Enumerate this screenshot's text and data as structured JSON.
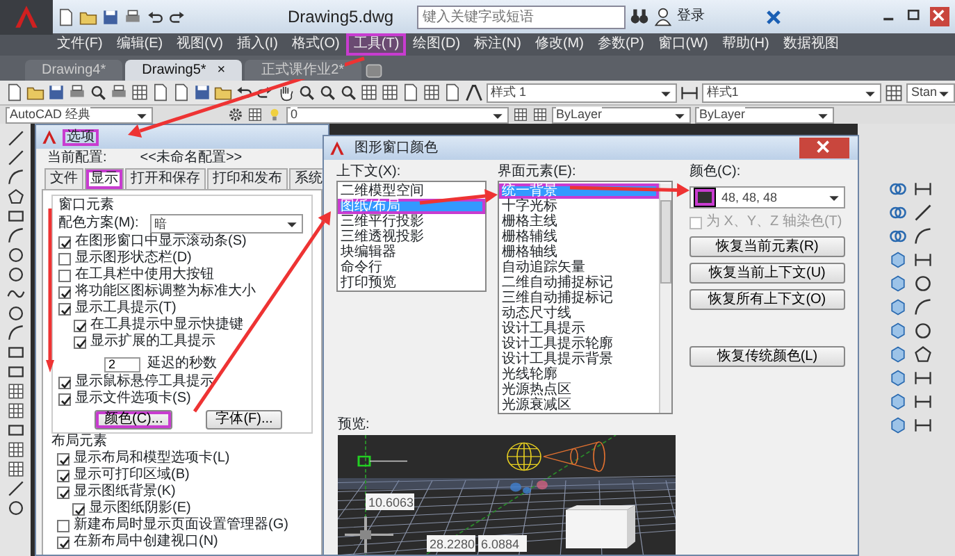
{
  "app": {
    "title": "Drawing5.dwg",
    "search_placeholder": "键入关键字或短语",
    "user": "登录"
  },
  "menu": [
    {
      "label": "文件(F)",
      "highlighted": false
    },
    {
      "label": "编辑(E)",
      "highlighted": false
    },
    {
      "label": "视图(V)",
      "highlighted": false
    },
    {
      "label": "插入(I)",
      "highlighted": false
    },
    {
      "label": "格式(O)",
      "highlighted": false
    },
    {
      "label": "工具(T)",
      "highlighted": true
    },
    {
      "label": "绘图(D)",
      "highlighted": false
    },
    {
      "label": "标注(N)",
      "highlighted": false
    },
    {
      "label": "修改(M)",
      "highlighted": false
    },
    {
      "label": "参数(P)",
      "highlighted": false
    },
    {
      "label": "窗口(W)",
      "highlighted": false
    },
    {
      "label": "帮助(H)",
      "highlighted": false
    },
    {
      "label": "数据视图",
      "highlighted": false
    }
  ],
  "doc_tabs": [
    {
      "label": "Drawing4*",
      "selected": false
    },
    {
      "label": "Drawing5*",
      "selected": true,
      "close": "×"
    },
    {
      "label": "正式课作业2*",
      "selected": false
    }
  ],
  "toolbar": {
    "text_style": "样式 1",
    "dim_style": "样式1",
    "table_style": "Stan"
  },
  "properties_bar": {
    "workspace": "AutoCAD 经典",
    "layer": "0",
    "color_setting": "ByLayer",
    "linetype": "ByLayer"
  },
  "options_dialog": {
    "title": "选项",
    "title_highlighted": true,
    "profile_label": "当前配置:",
    "profile": "<<未命名配置>>",
    "tabs": [
      {
        "label": "文件",
        "selected": false,
        "highlighted": false
      },
      {
        "label": "显示",
        "selected": true,
        "highlighted": true
      },
      {
        "label": "打开和保存",
        "selected": false,
        "highlighted": false
      },
      {
        "label": "打印和发布",
        "selected": false,
        "highlighted": false
      },
      {
        "label": "系统",
        "selected": false,
        "highlighted": false
      }
    ],
    "window_elements": {
      "title": "窗口元素",
      "scheme_label": "配色方案(M):",
      "scheme": "暗",
      "options": [
        {
          "kind": "checkbox",
          "label": "在图形窗口中显示滚动条(S)",
          "checked": true
        },
        {
          "kind": "checkbox",
          "label": "显示图形状态栏(D)",
          "checked": false
        },
        {
          "kind": "checkbox",
          "label": "在工具栏中使用大按钮",
          "checked": false
        },
        {
          "kind": "checkbox",
          "label": "将功能区图标调整为标准大小",
          "checked": true
        },
        {
          "kind": "checkbox",
          "label": "显示工具提示(T)",
          "checked": true,
          "children": [
            {
              "kind": "checkbox",
              "label": "在工具提示中显示快捷键",
              "checked": true
            },
            {
              "kind": "checkbox",
              "label": "显示扩展的工具提示",
              "checked": true
            },
            {
              "kind": "number",
              "value": "2",
              "label": "延迟的秒数"
            }
          ]
        },
        {
          "kind": "checkbox",
          "label": "显示鼠标悬停工具提示",
          "checked": true
        },
        {
          "kind": "checkbox",
          "label": "显示文件选项卡(S)",
          "checked": true
        }
      ],
      "buttons": [
        {
          "label": "颜色(C)...",
          "highlighted": true
        },
        {
          "label": "字体(F)...",
          "highlighted": false
        }
      ]
    },
    "layout_elements": {
      "title": "布局元素",
      "options": [
        {
          "kind": "checkbox",
          "label": "显示布局和模型选项卡(L)",
          "checked": true
        },
        {
          "kind": "checkbox",
          "label": "显示可打印区域(B)",
          "checked": true
        },
        {
          "kind": "checkbox",
          "label": "显示图纸背景(K)",
          "checked": true,
          "children": [
            {
              "kind": "checkbox",
              "label": "显示图纸阴影(E)",
              "checked": true
            }
          ]
        },
        {
          "kind": "checkbox",
          "label": "新建布局时显示页面设置管理器(G)",
          "checked": false
        },
        {
          "kind": "checkbox",
          "label": "在新布局中创建视口(N)",
          "checked": true
        }
      ]
    }
  },
  "color_dialog": {
    "title": "图形窗口颜色",
    "context_label": "上下文(X):",
    "contexts": [
      {
        "label": "二维模型空间",
        "selected": false,
        "highlighted": false
      },
      {
        "label": "图纸/布局",
        "selected": true,
        "highlighted": true
      },
      {
        "label": "三维平行投影",
        "selected": false,
        "highlighted": false
      },
      {
        "label": "三维透视投影",
        "selected": false,
        "highlighted": false
      },
      {
        "label": "块编辑器",
        "selected": false,
        "highlighted": false
      },
      {
        "label": "命令行",
        "selected": false,
        "highlighted": false
      },
      {
        "label": "打印预览",
        "selected": false,
        "highlighted": false
      }
    ],
    "elements_label": "界面元素(E):",
    "elements": [
      {
        "label": "统一背景",
        "selected": true,
        "highlighted": true
      },
      {
        "label": "十字光标",
        "selected": false,
        "highlighted": false
      },
      {
        "label": "栅格主线",
        "selected": false,
        "highlighted": false
      },
      {
        "label": "栅格辅线",
        "selected": false,
        "highlighted": false
      },
      {
        "label": "栅格轴线",
        "selected": false,
        "highlighted": false
      },
      {
        "label": "自动追踪矢量",
        "selected": false,
        "highlighted": false
      },
      {
        "label": "二维自动捕捉标记",
        "selected": false,
        "highlighted": false
      },
      {
        "label": "三维自动捕捉标记",
        "selected": false,
        "highlighted": false
      },
      {
        "label": "动态尺寸线",
        "selected": false,
        "highlighted": false
      },
      {
        "label": "设计工具提示",
        "selected": false,
        "highlighted": false
      },
      {
        "label": "设计工具提示轮廓",
        "selected": false,
        "highlighted": false
      },
      {
        "label": "设计工具提示背景",
        "selected": false,
        "highlighted": false
      },
      {
        "label": "光线轮廓",
        "selected": false,
        "highlighted": false
      },
      {
        "label": "光源热点区",
        "selected": false,
        "highlighted": false
      },
      {
        "label": "光源衰减区",
        "selected": false,
        "highlighted": false
      }
    ],
    "color_label": "颜色(C):",
    "color": {
      "value": "48, 48, 48",
      "highlighted": true
    },
    "tint_axes": {
      "kind": "checkbox",
      "label": "为 X、Y、Z 轴染色(T)",
      "checked": false,
      "disabled": true
    },
    "buttons": [
      {
        "label": "恢复当前元素(R)"
      },
      {
        "label": "恢复当前上下文(U)"
      },
      {
        "label": "恢复所有上下文(O)"
      },
      {
        "label": "恢复传统颜色(L)"
      }
    ],
    "preview_label": "预览:",
    "preview_values": [
      "10.6063",
      "28.2280",
      "6.0884"
    ]
  }
}
